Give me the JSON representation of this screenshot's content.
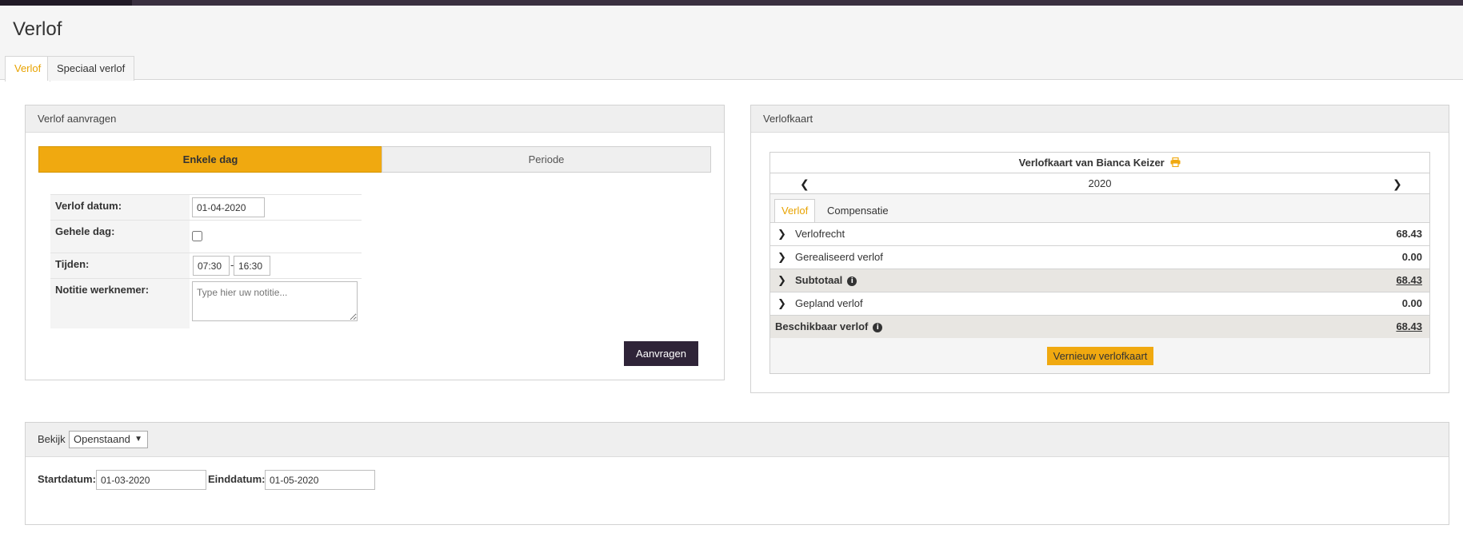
{
  "page": {
    "title": "Verlof"
  },
  "tabs": [
    {
      "label": "Verlof",
      "active": true
    },
    {
      "label": "Speciaal verlof",
      "active": false
    }
  ],
  "request_panel": {
    "title": "Verlof aanvragen",
    "modes": {
      "single": "Enkele dag",
      "period": "Periode"
    },
    "labels": {
      "date": "Verlof datum:",
      "whole_day": "Gehele dag:",
      "times": "Tijden:",
      "note": "Notitie werknemer:"
    },
    "date_value": "01-04-2020",
    "whole_day_checked": false,
    "time_from": "07:30",
    "time_sep": "-",
    "time_to": "16:30",
    "note_placeholder": "Type hier uw notitie...",
    "submit": "Aanvragen"
  },
  "card_panel": {
    "title": "Verlofkaart",
    "card_title": "Verlofkaart van Bianca Keizer",
    "year": "2020",
    "inner_tabs": [
      "Verlof",
      "Compensatie"
    ],
    "rows": [
      {
        "label": "Verlofrecht",
        "value": "68.43"
      },
      {
        "label": "Gerealiseerd verlof",
        "value": "0.00"
      },
      {
        "label": "Subtotaal",
        "value": "68.43"
      },
      {
        "label": "Gepland verlof",
        "value": "0.00"
      },
      {
        "label": "Beschikbaar verlof",
        "value": "68.43"
      }
    ],
    "refresh": "Vernieuw verlofkaart"
  },
  "overview_panel": {
    "view_label": "Bekijk",
    "view_value": "Openstaand",
    "start_label": "Startdatum:",
    "start_value": "01-03-2020",
    "end_label": "Einddatum:",
    "end_value": "01-05-2020"
  },
  "colors": {
    "accent": "#f0a910",
    "dark": "#2f2438",
    "topbar": "#3a3040"
  }
}
